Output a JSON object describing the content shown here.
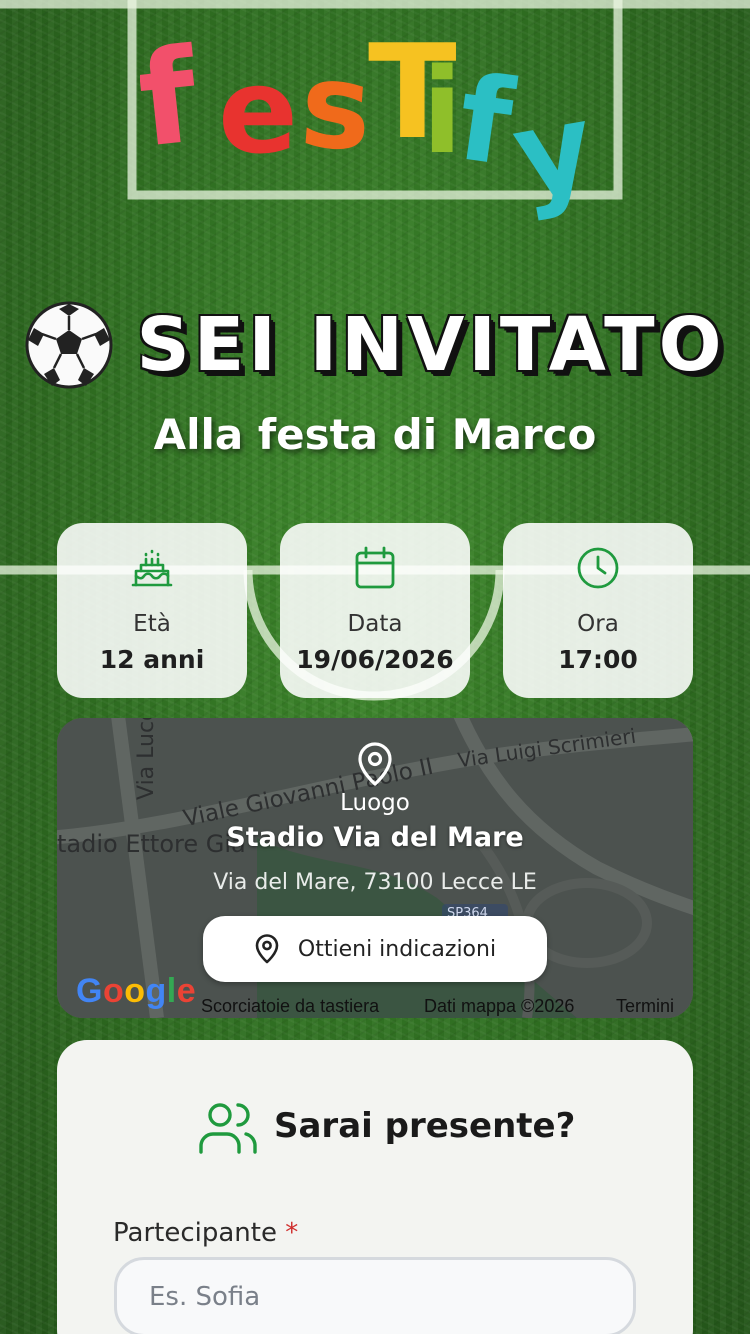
{
  "brand": {
    "logo_text": "festify",
    "colors": [
      "#f2506b",
      "#e8332f",
      "#f06a1b",
      "#f6c221",
      "#8fbf2a",
      "#2bbfc4"
    ]
  },
  "hero": {
    "headline": "SEI INVITATO",
    "subtitle": "Alla festa di Marco",
    "ball_icon": "soccer-ball-icon"
  },
  "info_cards": [
    {
      "icon": "birthday-cake-icon",
      "label": "Età",
      "value": "12 anni"
    },
    {
      "icon": "calendar-icon",
      "label": "Data",
      "value": "19/06/2026"
    },
    {
      "icon": "clock-icon",
      "label": "Ora",
      "value": "17:00"
    }
  ],
  "location": {
    "icon": "map-pin-icon",
    "label": "Luogo",
    "name": "Stadio Via del Mare",
    "address": "Via del Mare, 73100 Lecce LE",
    "directions_label": "Ottieni indicazioni",
    "map": {
      "streets": [
        "Via Lucc",
        "Viale Giovanni Paolo II",
        "Via Luigi Scrimieri",
        "tadio Ettore Gia"
      ],
      "road_badge": "SP364",
      "google": "Google",
      "footer": [
        "Scorciatoie da tastiera",
        "Dati mappa ©2026",
        "Termini"
      ]
    }
  },
  "rsvp": {
    "icon": "users-icon",
    "title": "Sarai presente?",
    "participant_label": "Partecipante",
    "required_mark": "*",
    "participant_placeholder": "Es. Sofia",
    "participant_value": ""
  },
  "accent_color": "#1f9a3e"
}
